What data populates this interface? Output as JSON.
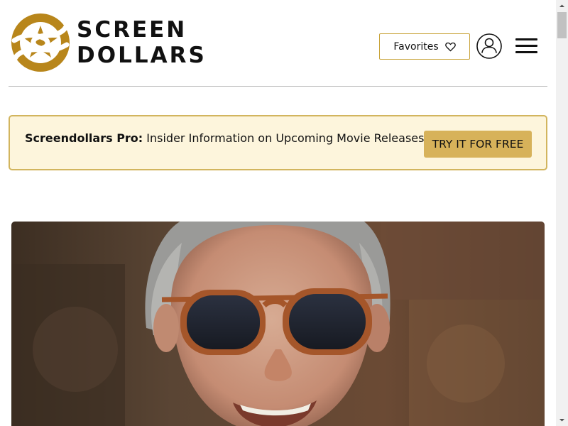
{
  "header": {
    "logo": {
      "line1": "SCREEN",
      "line2": "DOLLARS",
      "colors": {
        "gold": "#b8861b",
        "text": "#111111"
      }
    },
    "favorites_label": "Favorites",
    "icons": [
      "heart-icon",
      "user-icon",
      "hamburger-menu-icon"
    ]
  },
  "promo": {
    "lead": "Screendollars Pro:",
    "text": " Insider Information on Upcoming Movie Releases",
    "cta_label": "TRY IT FOR FREE",
    "colors": {
      "background": "#fdf5dc",
      "border": "#d2b55e",
      "button": "#d7b25a"
    }
  },
  "hero": {
    "image": "portrait-man-sunglasses"
  },
  "scrollbar": {
    "icons": [
      "scroll-up-arrow-icon",
      "scroll-down-arrow-icon"
    ]
  }
}
